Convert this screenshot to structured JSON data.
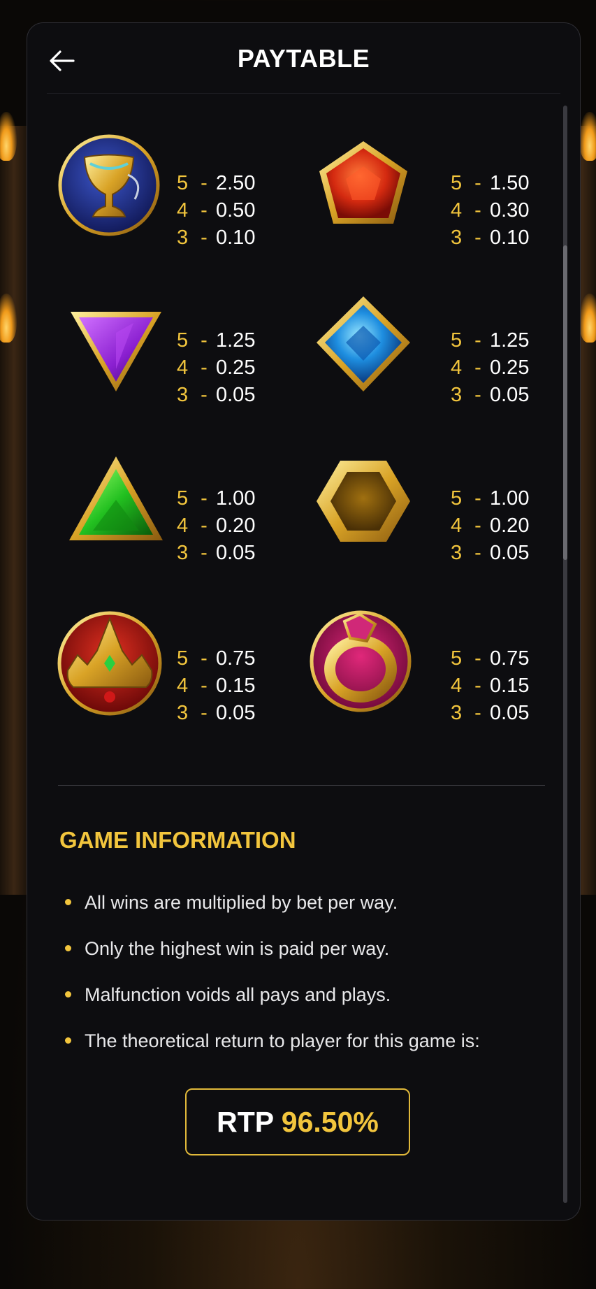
{
  "header": {
    "title": "PAYTABLE"
  },
  "symbols": [
    {
      "name": "golden-chalice",
      "pays": [
        [
          "5",
          "-",
          "2.50"
        ],
        [
          "4",
          "-",
          "0.50"
        ],
        [
          "3",
          "-",
          "0.10"
        ]
      ]
    },
    {
      "name": "red-pentagon-gem",
      "pays": [
        [
          "5",
          "-",
          "1.50"
        ],
        [
          "4",
          "-",
          "0.30"
        ],
        [
          "3",
          "-",
          "0.10"
        ]
      ]
    },
    {
      "name": "purple-triangle-gem",
      "pays": [
        [
          "5",
          "-",
          "1.25"
        ],
        [
          "4",
          "-",
          "0.25"
        ],
        [
          "3",
          "-",
          "0.05"
        ]
      ]
    },
    {
      "name": "blue-diamond-gem",
      "pays": [
        [
          "5",
          "-",
          "1.25"
        ],
        [
          "4",
          "-",
          "0.25"
        ],
        [
          "3",
          "-",
          "0.05"
        ]
      ]
    },
    {
      "name": "green-triangle-gem",
      "pays": [
        [
          "5",
          "-",
          "1.00"
        ],
        [
          "4",
          "-",
          "0.20"
        ],
        [
          "3",
          "-",
          "0.05"
        ]
      ]
    },
    {
      "name": "gold-hexagon-gem",
      "pays": [
        [
          "5",
          "-",
          "1.00"
        ],
        [
          "4",
          "-",
          "0.20"
        ],
        [
          "3",
          "-",
          "0.05"
        ]
      ]
    },
    {
      "name": "golden-crown",
      "pays": [
        [
          "5",
          "-",
          "0.75"
        ],
        [
          "4",
          "-",
          "0.15"
        ],
        [
          "3",
          "-",
          "0.05"
        ]
      ]
    },
    {
      "name": "gold-ring",
      "pays": [
        [
          "5",
          "-",
          "0.75"
        ],
        [
          "4",
          "-",
          "0.15"
        ],
        [
          "3",
          "-",
          "0.05"
        ]
      ]
    }
  ],
  "game_info": {
    "title": "GAME INFORMATION",
    "items": [
      "All wins are multiplied by bet per way.",
      "Only the highest win is paid per way.",
      "Malfunction voids all pays and plays.",
      "The theoretical return to player for this game is:"
    ],
    "rtp_label": "RTP",
    "rtp_value": "96.50%"
  },
  "colors": {
    "accent": "#f2c53d",
    "panel": "#0d0d10",
    "text": "#ffffff"
  },
  "icons": {
    "back": "arrow-left-icon"
  }
}
